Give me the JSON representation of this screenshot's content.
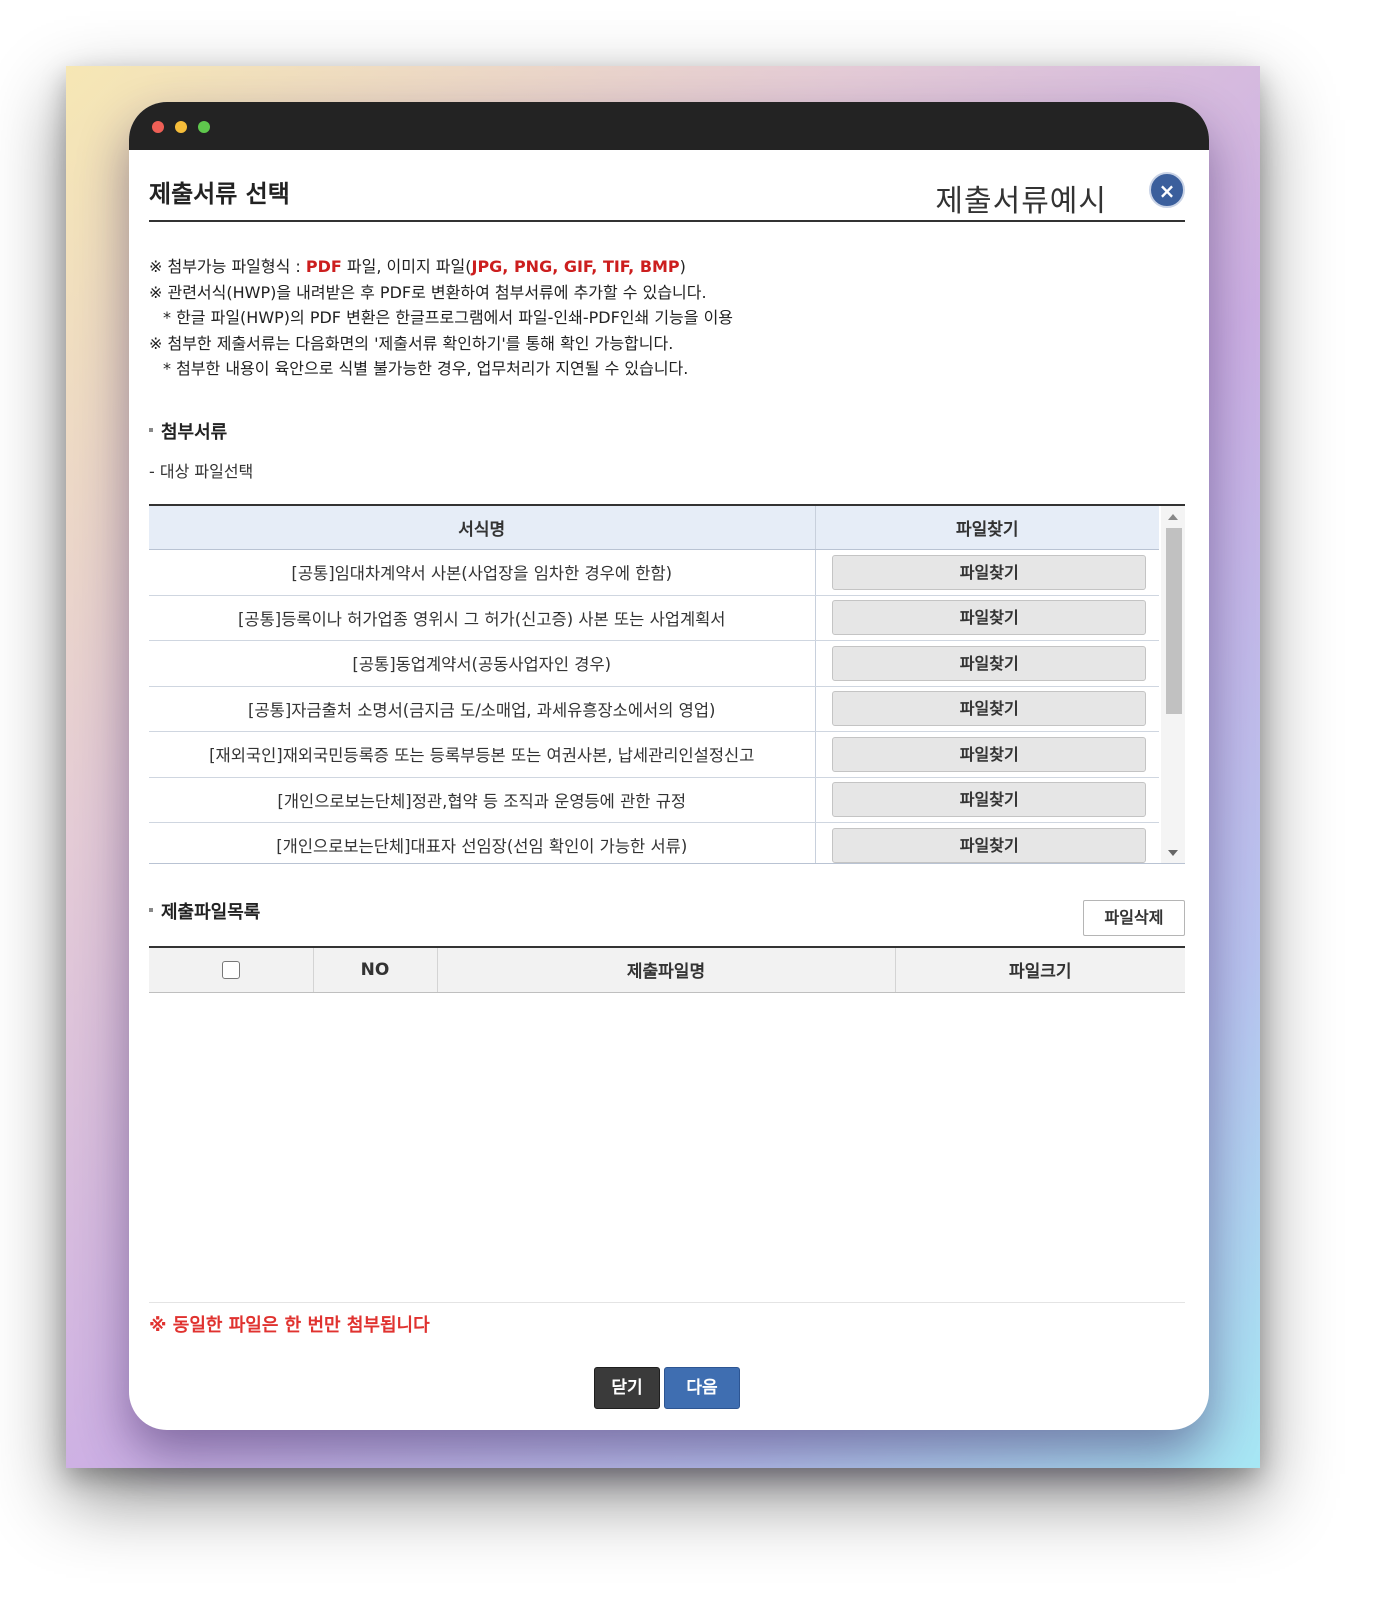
{
  "window": {
    "title_bar_dots": [
      "red",
      "yellow",
      "green"
    ]
  },
  "header": {
    "title": "제출서류 선택",
    "example_label": "제출서류예시",
    "close_symbol": "×"
  },
  "notices": {
    "line1_prefix": "※ 첨부가능 파일형식 : ",
    "line1_pdf": "PDF",
    "line1_mid": " 파일, 이미지 파일(",
    "line1_formats": "JPG, PNG, GIF, TIF, BMP",
    "line1_suffix": ")",
    "line2": "※ 관련서식(HWP)을 내려받은 후 PDF로 변환하여 첨부서류에 추가할 수 있습니다.",
    "line3": "* 한글 파일(HWP)의 PDF 변환은 한글프로그램에서 파일-인쇄-PDF인쇄 기능을 이용",
    "line4": "※ 첨부한 제출서류는 다음화면의 '제출서류 확인하기'를 통해 확인 가능합니다.",
    "line5": "* 첨부한 내용이 육안으로 식별 불가능한 경우, 업무처리가 지연될 수 있습니다."
  },
  "attachments": {
    "section_title": "첨부서류",
    "sub_label": "- 대상 파일선택",
    "columns": [
      "서식명",
      "파일찾기"
    ],
    "rows": [
      {
        "name": "[공통]임대차계약서 사본(사업장을 임차한 경우에 한함)",
        "button": "파일찾기"
      },
      {
        "name": "[공통]등록이나 허가업종 영위시 그 허가(신고증) 사본 또는 사업계획서",
        "button": "파일찾기"
      },
      {
        "name": "[공통]동업계약서(공동사업자인 경우)",
        "button": "파일찾기"
      },
      {
        "name": "[공통]자금출처 소명서(금지금 도/소매업, 과세유흥장소에서의 영업)",
        "button": "파일찾기"
      },
      {
        "name": "[재외국인]재외국민등록증 또는 등록부등본 또는 여권사본, 납세관리인설정신고",
        "button": "파일찾기"
      },
      {
        "name": "[개인으로보는단체]정관,협약 등 조직과 운영등에 관한 규정",
        "button": "파일찾기"
      },
      {
        "name": "[개인으로보는단체]대표자 선임장(선임 확인이 가능한 서류)",
        "button": "파일찾기"
      }
    ]
  },
  "submitted_files": {
    "section_title": "제출파일목록",
    "delete_button": "파일삭제",
    "columns": [
      "NO",
      "제출파일명",
      "파일크기"
    ],
    "rows": []
  },
  "warning": "※ 동일한 파일은 한 번만 첨부됩니다",
  "footer": {
    "close_button": "닫기",
    "next_button": "다음"
  },
  "colors": {
    "accent_red": "#cc1e1e",
    "primary_blue": "#3f6eb1",
    "dark_button": "#3a3a3a",
    "table_header_bg": "#e6edf7"
  }
}
